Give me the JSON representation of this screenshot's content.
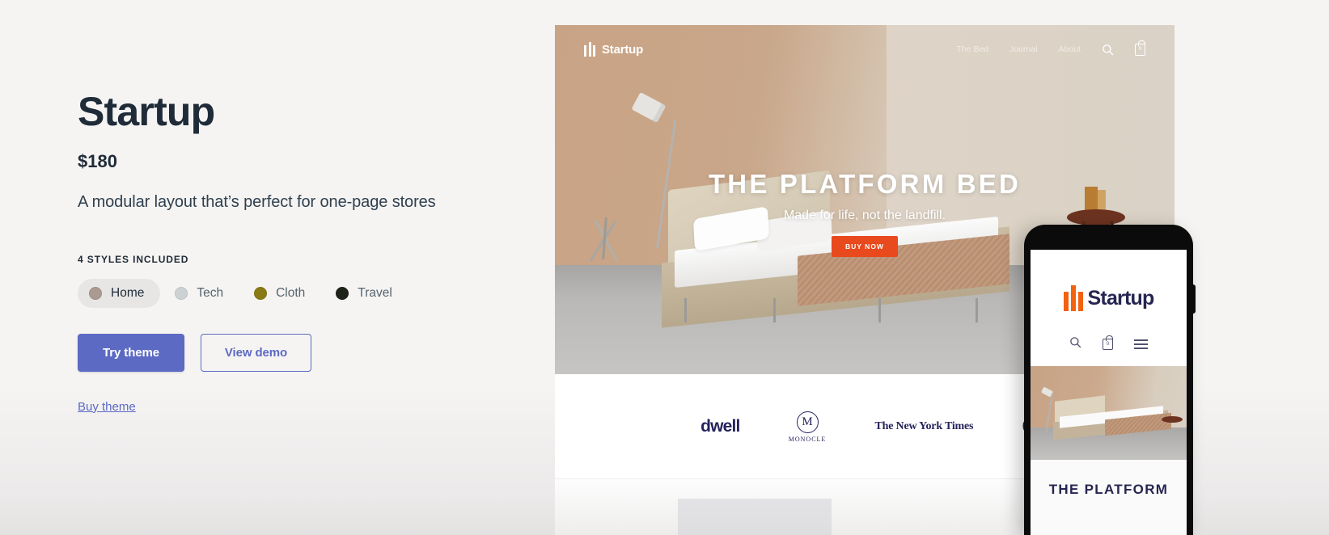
{
  "theme": {
    "name": "Startup",
    "price": "$180",
    "description": "A modular layout that’s perfect for one-page stores",
    "styles_label": "4 STYLES INCLUDED",
    "styles": [
      {
        "label": "Home",
        "color": "#ab9a91",
        "selected": true
      },
      {
        "label": "Tech",
        "color": "#ccd2d4",
        "selected": false
      },
      {
        "label": "Cloth",
        "color": "#8a7a16",
        "selected": false
      },
      {
        "label": "Travel",
        "color": "#1f241a",
        "selected": false
      }
    ],
    "primary_button": "Try theme",
    "secondary_button": "View demo",
    "buy_link": "Buy theme",
    "accent_color": "#5c6ac4"
  },
  "preview": {
    "nav": {
      "brand": "Startup",
      "links": [
        "The Bed",
        "Journal",
        "About"
      ],
      "cart_count": "0"
    },
    "hero": {
      "title": "THE PLATFORM BED",
      "subtitle": "Made for life, not the landfill.",
      "cta": "BUY NOW",
      "cta_color": "#e8491d"
    },
    "press": {
      "dwell": "dwell",
      "monocle_mark": "M",
      "monocle": "MONOCLE",
      "nyt": "The New York Times",
      "google": "G"
    }
  },
  "phone": {
    "brand": "Startup",
    "cart_count": "0",
    "hero_title": "THE PLATFORM"
  }
}
